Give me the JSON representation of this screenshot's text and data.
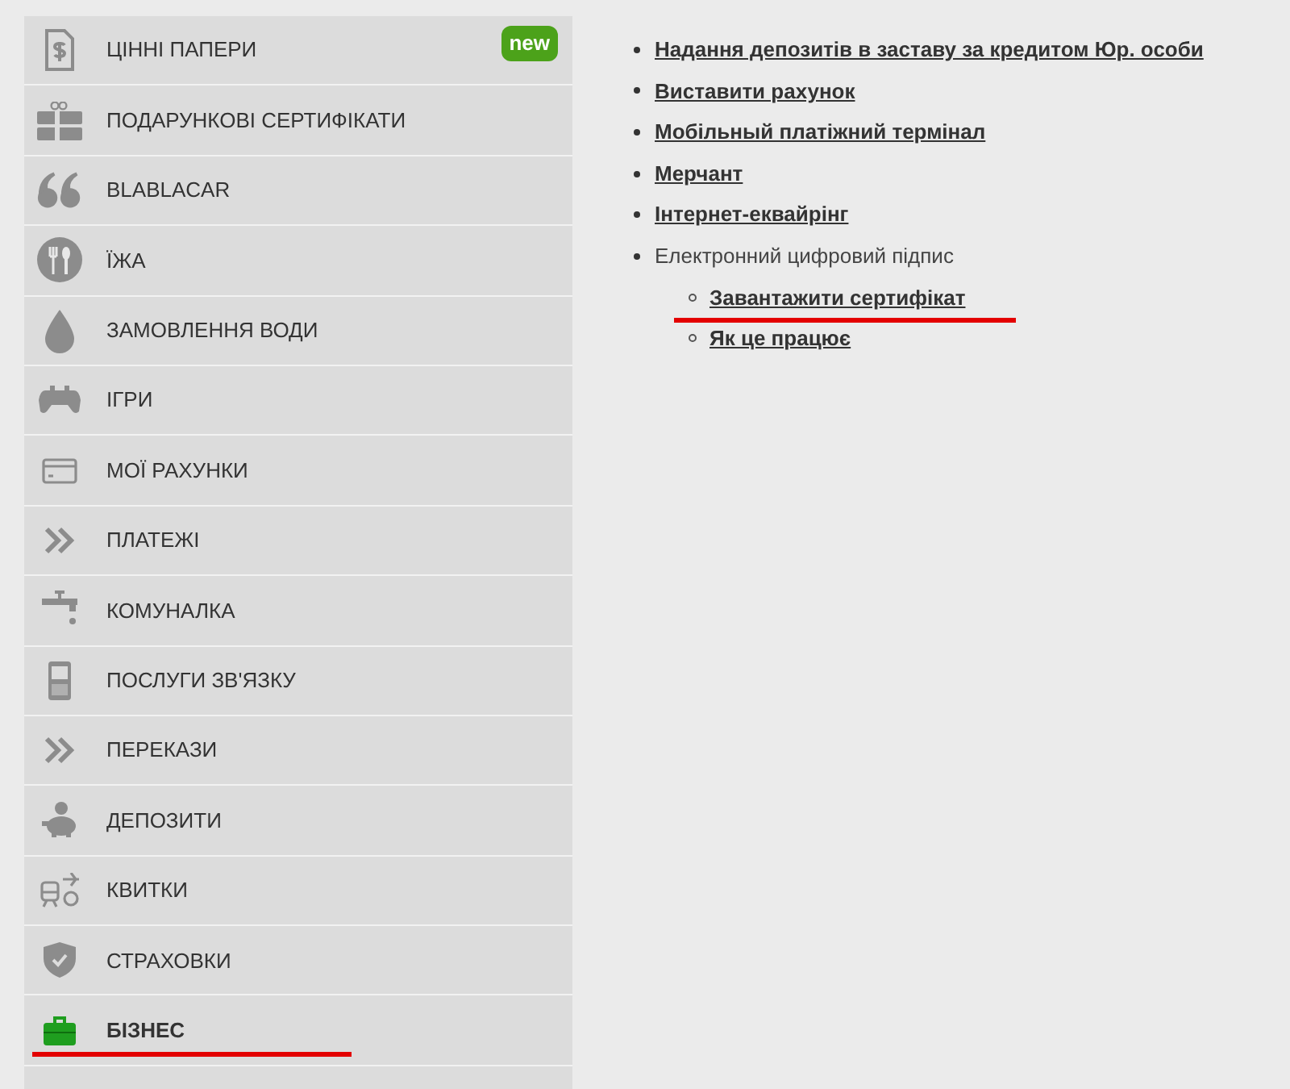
{
  "sidebar": {
    "items": [
      {
        "label": "ЦІННІ ПАПЕРИ",
        "badge": "new",
        "selected": false,
        "highlighted": false
      },
      {
        "label": "ПОДАРУНКОВІ СЕРТИФІКАТИ",
        "selected": false,
        "highlighted": false
      },
      {
        "label": "BLABLACAR",
        "selected": false,
        "highlighted": false
      },
      {
        "label": "ЇЖА",
        "selected": false,
        "highlighted": false
      },
      {
        "label": "ЗАМОВЛЕННЯ ВОДИ",
        "selected": false,
        "highlighted": false
      },
      {
        "label": "ІГРИ",
        "selected": false,
        "highlighted": false
      },
      {
        "label": "МОЇ РАХУНКИ",
        "selected": false,
        "highlighted": false
      },
      {
        "label": "ПЛАТЕЖІ",
        "selected": false,
        "highlighted": false
      },
      {
        "label": "КОМУНАЛКА",
        "selected": false,
        "highlighted": false
      },
      {
        "label": "ПОСЛУГИ ЗВ'ЯЗКУ",
        "selected": false,
        "highlighted": false
      },
      {
        "label": "ПЕРЕКАЗИ",
        "selected": false,
        "highlighted": false
      },
      {
        "label": "ДЕПОЗИТИ",
        "selected": false,
        "highlighted": false
      },
      {
        "label": "КВИТКИ",
        "selected": false,
        "highlighted": false
      },
      {
        "label": "СТРАХОВКИ",
        "selected": false,
        "highlighted": false
      },
      {
        "label": "БІЗНЕС",
        "selected": true,
        "highlighted": true
      }
    ]
  },
  "content": {
    "items": [
      {
        "kind": "link",
        "text": "Надання депозитів в заставу за кредитом Юр. особи"
      },
      {
        "kind": "link",
        "text": "Виставити рахунок"
      },
      {
        "kind": "link",
        "text": "Мобільный платіжний термінал"
      },
      {
        "kind": "link",
        "text": "Мерчант"
      },
      {
        "kind": "link",
        "text": "Інтернет-еквайрінг"
      },
      {
        "kind": "plain",
        "text": "Електронний цифровий підпис",
        "children": [
          {
            "kind": "link",
            "text": "Завантажити сертифікат",
            "highlighted": true
          },
          {
            "kind": "link",
            "text": "Як це працює",
            "highlighted": false
          }
        ]
      }
    ]
  }
}
